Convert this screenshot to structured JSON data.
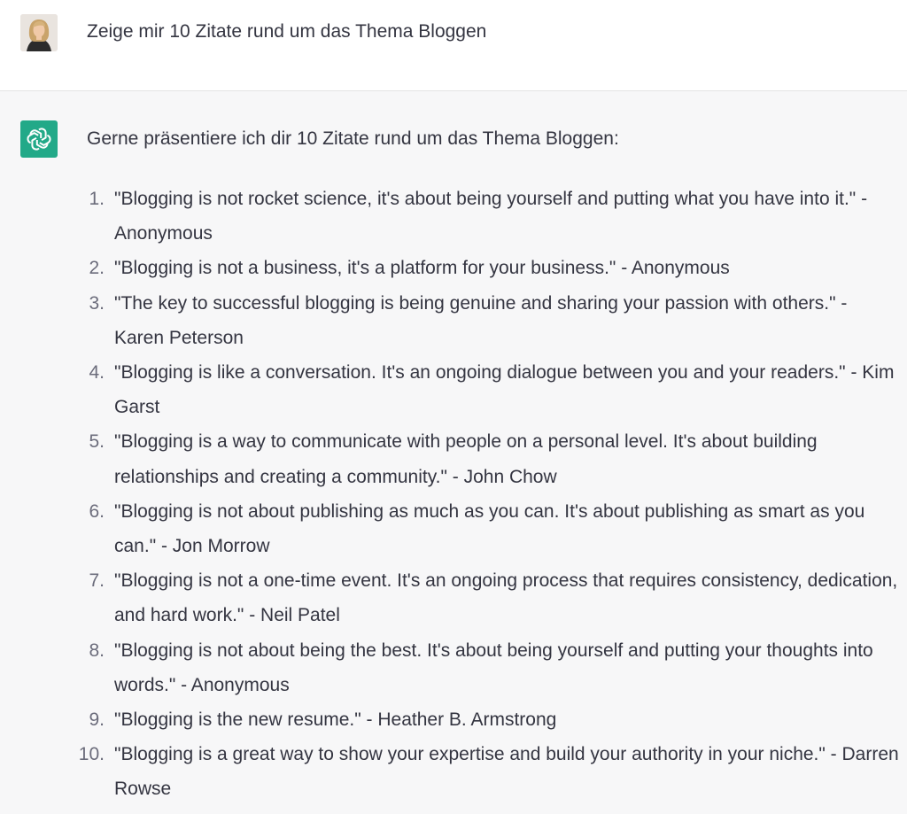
{
  "user_message": {
    "text": "Zeige mir 10 Zitate rund um das Thema Bloggen"
  },
  "assistant_message": {
    "intro": "Gerne präsentiere ich dir 10 Zitate rund um das Thema Bloggen:",
    "quotes": [
      {
        "num": "1.",
        "text": "\"Blogging is not rocket science, it's about being yourself and putting what you have into it.\" - Anonymous"
      },
      {
        "num": "2.",
        "text": "\"Blogging is not a business, it's a platform for your business.\" - Anonymous"
      },
      {
        "num": "3.",
        "text": "\"The key to successful blogging is being genuine and sharing your passion with others.\" - Karen Peterson"
      },
      {
        "num": "4.",
        "text": "\"Blogging is like a conversation. It's an ongoing dialogue between you and your readers.\" - Kim Garst"
      },
      {
        "num": "5.",
        "text": "\"Blogging is a way to communicate with people on a personal level. It's about building relationships and creating a community.\" - John Chow"
      },
      {
        "num": "6.",
        "text": "\"Blogging is not about publishing as much as you can. It's about publishing as smart as you can.\" - Jon Morrow"
      },
      {
        "num": "7.",
        "text": "\"Blogging is not a one-time event. It's an ongoing process that requires consistency, dedication, and hard work.\" - Neil Patel"
      },
      {
        "num": "8.",
        "text": "\"Blogging is not about being the best. It's about being yourself and putting your thoughts into words.\" - Anonymous"
      },
      {
        "num": "9.",
        "text": "\"Blogging is the new resume.\" - Heather B. Armstrong"
      },
      {
        "num": "10.",
        "text": "\"Blogging is a great way to show your expertise and build your authority in your niche.\" - Darren Rowse"
      }
    ]
  },
  "icons": {
    "user_avatar": "avatar",
    "assistant_avatar": "openai-logo-icon"
  },
  "colors": {
    "assistant_avatar_bg": "#10a37f",
    "user_row_bg": "#ffffff",
    "assistant_row_bg": "#f7f7f8"
  }
}
